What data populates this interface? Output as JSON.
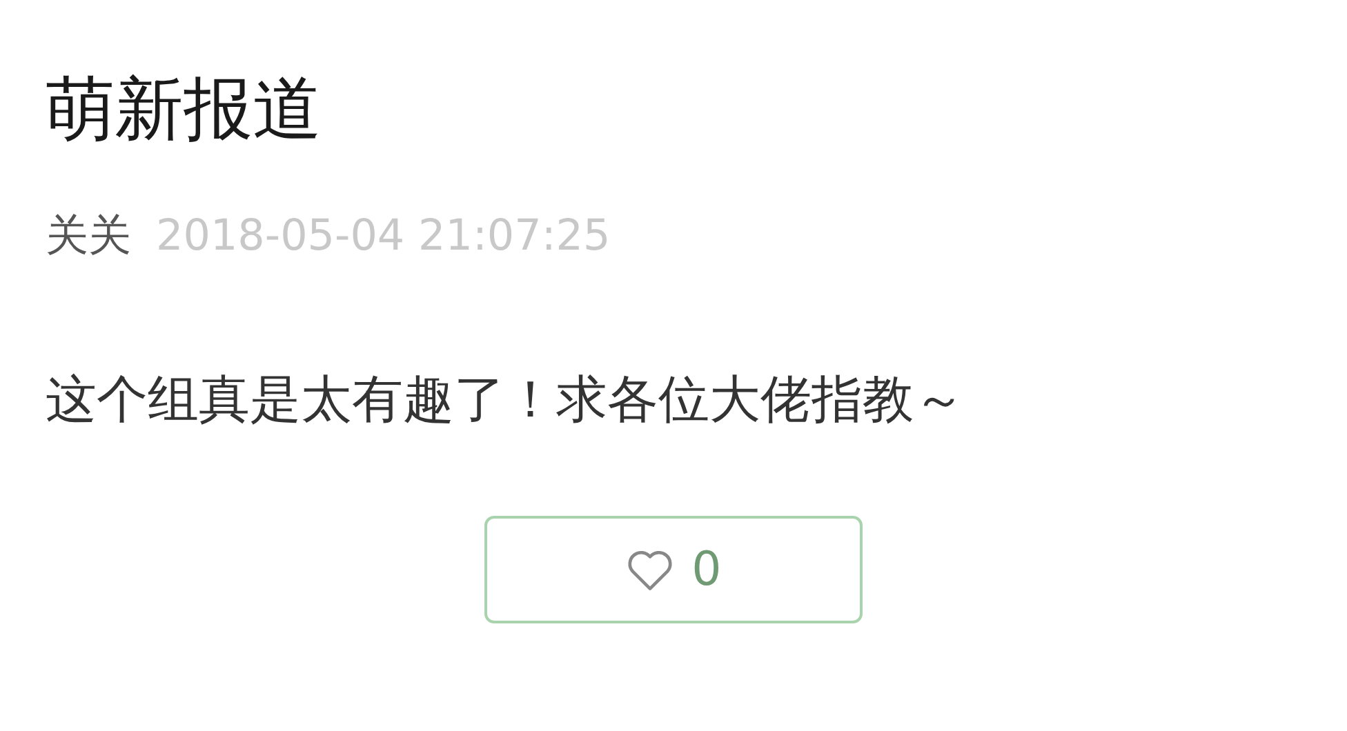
{
  "post": {
    "title": "萌新报道",
    "author": "关关",
    "time": "2018-05-04 21:07:25",
    "content": "这个组真是太有趣了！求各位大佬指教～"
  },
  "like_button": {
    "count": "0"
  }
}
